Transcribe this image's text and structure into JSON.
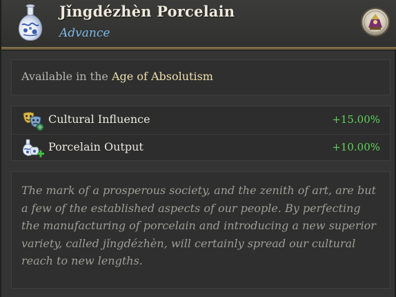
{
  "header": {
    "title": "Jǐngdézhèn Porcelain",
    "subtitle": "Advance",
    "icon": "porcelain-vase-icon",
    "badge_icon": "age-emblem-icon"
  },
  "availability": {
    "prefix": "Available in the",
    "age": "Age of Absolutism"
  },
  "modifiers": [
    {
      "icon": "theater-masks-icon",
      "label": "Cultural Influence",
      "value": "+15.00%"
    },
    {
      "icon": "porcelain-plus-icon",
      "label": "Porcelain Output",
      "value": "+10.00%"
    }
  ],
  "flavor": {
    "text": "The mark of a prosperous society, and the zenith of art, are but a few of the established aspects of our people. By perfecting the manufacturing of porcelain and introducing a new superior variety, called jǐngdézhèn, will certainly spread our cultural reach to new lengths."
  },
  "colors": {
    "subtitle": "#7fb7e6",
    "age_highlight": "#f1dfae",
    "positive": "#5fd35d",
    "divider_gold": "#8a7a52"
  }
}
